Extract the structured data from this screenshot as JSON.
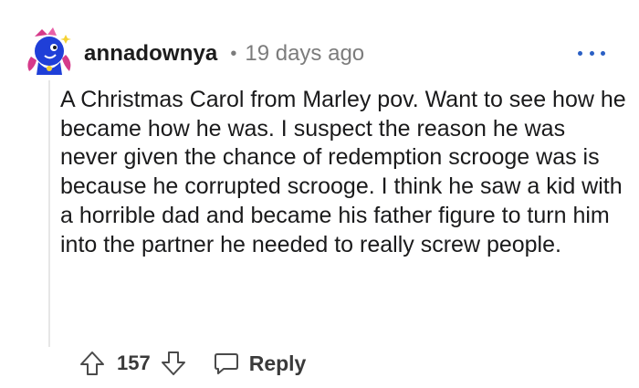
{
  "comment": {
    "author": "annadownya",
    "separator": "•",
    "timestamp": "19 days ago",
    "body": "A Christmas Carol from Marley pov. Want to see how he became how he was. I suspect the reason he was never given the chance of redemption scrooge was is because he corrupted scrooge. I think he saw a kid with a horrible dad and became his father figure to turn him into the partner he needed to really screw people.",
    "votes": "157",
    "reply_label": "Reply"
  },
  "icons": {
    "avatar": "user-avatar-icon",
    "more": "more-options-icon",
    "upvote": "upvote-arrow-icon",
    "downvote": "downvote-arrow-icon",
    "reply": "speech-bubble-icon"
  },
  "colors": {
    "accent": "#2a5fc4",
    "muted_text": "#7c7c7c",
    "text": "#1a1a1b",
    "avatar_blue": "#1f3fd8",
    "avatar_pink": "#d63a8a"
  }
}
